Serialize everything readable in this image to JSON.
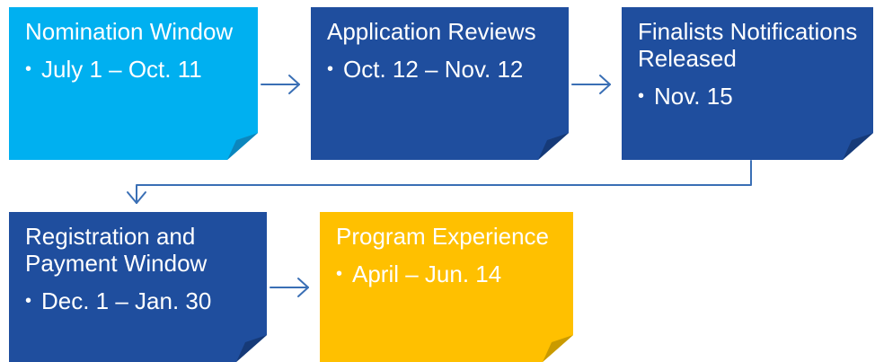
{
  "colors": {
    "light_blue": "#00b0f0",
    "dark_blue": "#1f4e9e",
    "yellow": "#ffc000",
    "connector": "#3a6fb5"
  },
  "steps": [
    {
      "title": "Nomination Window",
      "detail": "July 1 – Oct. 11"
    },
    {
      "title": "Application Reviews",
      "detail": "Oct. 12 – Nov. 12"
    },
    {
      "title": "Finalists Notifications Released",
      "detail": "Nov. 15"
    },
    {
      "title": "Registration and Payment Window",
      "detail": "Dec. 1 – Jan. 30"
    },
    {
      "title": "Program Experience",
      "detail": "April – Jun. 14"
    }
  ],
  "bullet_glyph": "•"
}
